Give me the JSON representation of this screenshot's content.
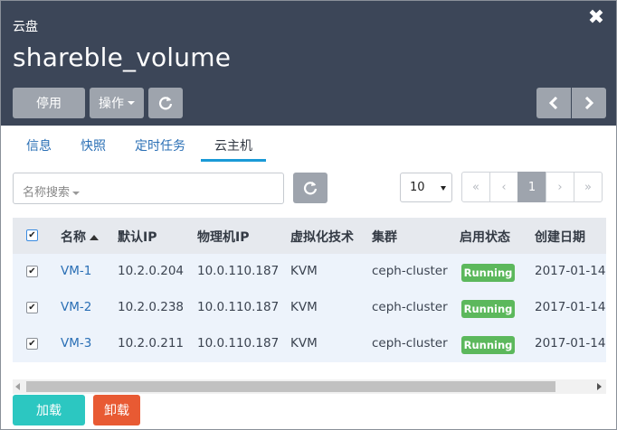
{
  "header": {
    "label": "云盘",
    "title": "shareble_volume",
    "close_glyph": "✖",
    "buttons": {
      "stop": "停用",
      "ops": "操作"
    }
  },
  "tabs": [
    "信息",
    "快照",
    "定时任务",
    "云主机"
  ],
  "active_tab": "云主机",
  "search": {
    "placeholder": "名称搜索"
  },
  "page_size": "10",
  "pager": [
    "«",
    "‹",
    "1",
    "›",
    "»"
  ],
  "table": {
    "headers": [
      "名称",
      "默认IP",
      "物理机IP",
      "虚拟化技术",
      "集群",
      "启用状态",
      "创建日期"
    ],
    "rows": [
      {
        "name": "VM-1",
        "ip": "10.2.0.204",
        "host_ip": "10.0.110.187",
        "virt": "KVM",
        "cluster": "ceph-cluster",
        "status": "Running",
        "date": "2017-01-14"
      },
      {
        "name": "VM-2",
        "ip": "10.2.0.238",
        "host_ip": "10.0.110.187",
        "virt": "KVM",
        "cluster": "ceph-cluster",
        "status": "Running",
        "date": "2017-01-14"
      },
      {
        "name": "VM-3",
        "ip": "10.2.0.211",
        "host_ip": "10.0.110.187",
        "virt": "KVM",
        "cluster": "ceph-cluster",
        "status": "Running",
        "date": "2017-01-14"
      }
    ]
  },
  "actions": {
    "mount": "加载",
    "unmount": "卸载"
  },
  "colors": {
    "header_bg": "#3c4658",
    "gray_button": "#9ea4ad",
    "link": "#2a6fb5",
    "tab_underline": "#1a9ad6",
    "running_badge": "#5cb85c",
    "mount_button": "#2cc7c1",
    "unmount_button": "#e85a33"
  },
  "icons": [
    "close-icon",
    "caret-down-icon",
    "refresh-icon",
    "chevron-left-icon",
    "chevron-right-icon",
    "sort-asc-icon",
    "checkbox-icon"
  ]
}
